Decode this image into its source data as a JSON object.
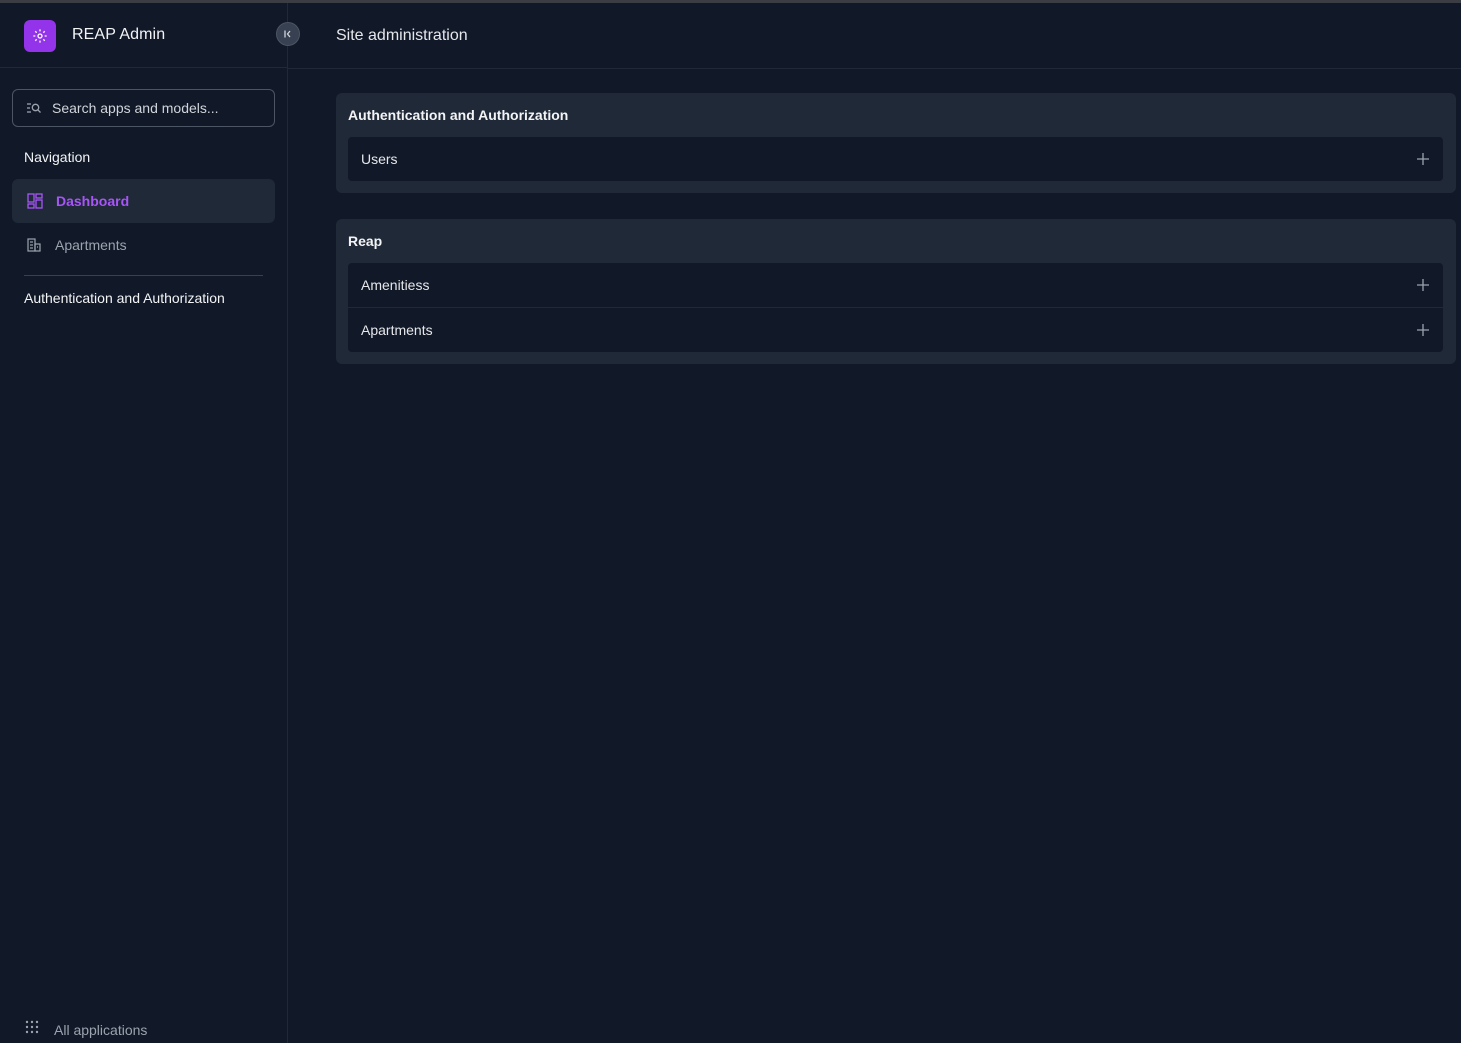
{
  "brand": {
    "title": "REAP Admin",
    "logo_icon": "gear-icon",
    "accent": "#9333ea"
  },
  "search": {
    "placeholder": "Search apps and models..."
  },
  "sidebar": {
    "navigation_heading": "Navigation",
    "items": [
      {
        "label": "Dashboard",
        "icon": "dashboard-icon",
        "active": true
      },
      {
        "label": "Apartments",
        "icon": "building-icon",
        "active": false
      }
    ],
    "section_link": "Authentication and Authorization",
    "all_applications": "All applications"
  },
  "header": {
    "title": "Site administration"
  },
  "modules": [
    {
      "title": "Authentication and Authorization",
      "models": [
        {
          "name": "Users"
        }
      ]
    },
    {
      "title": "Reap",
      "models": [
        {
          "name": "Amenitiess"
        },
        {
          "name": "Apartments"
        }
      ]
    }
  ]
}
